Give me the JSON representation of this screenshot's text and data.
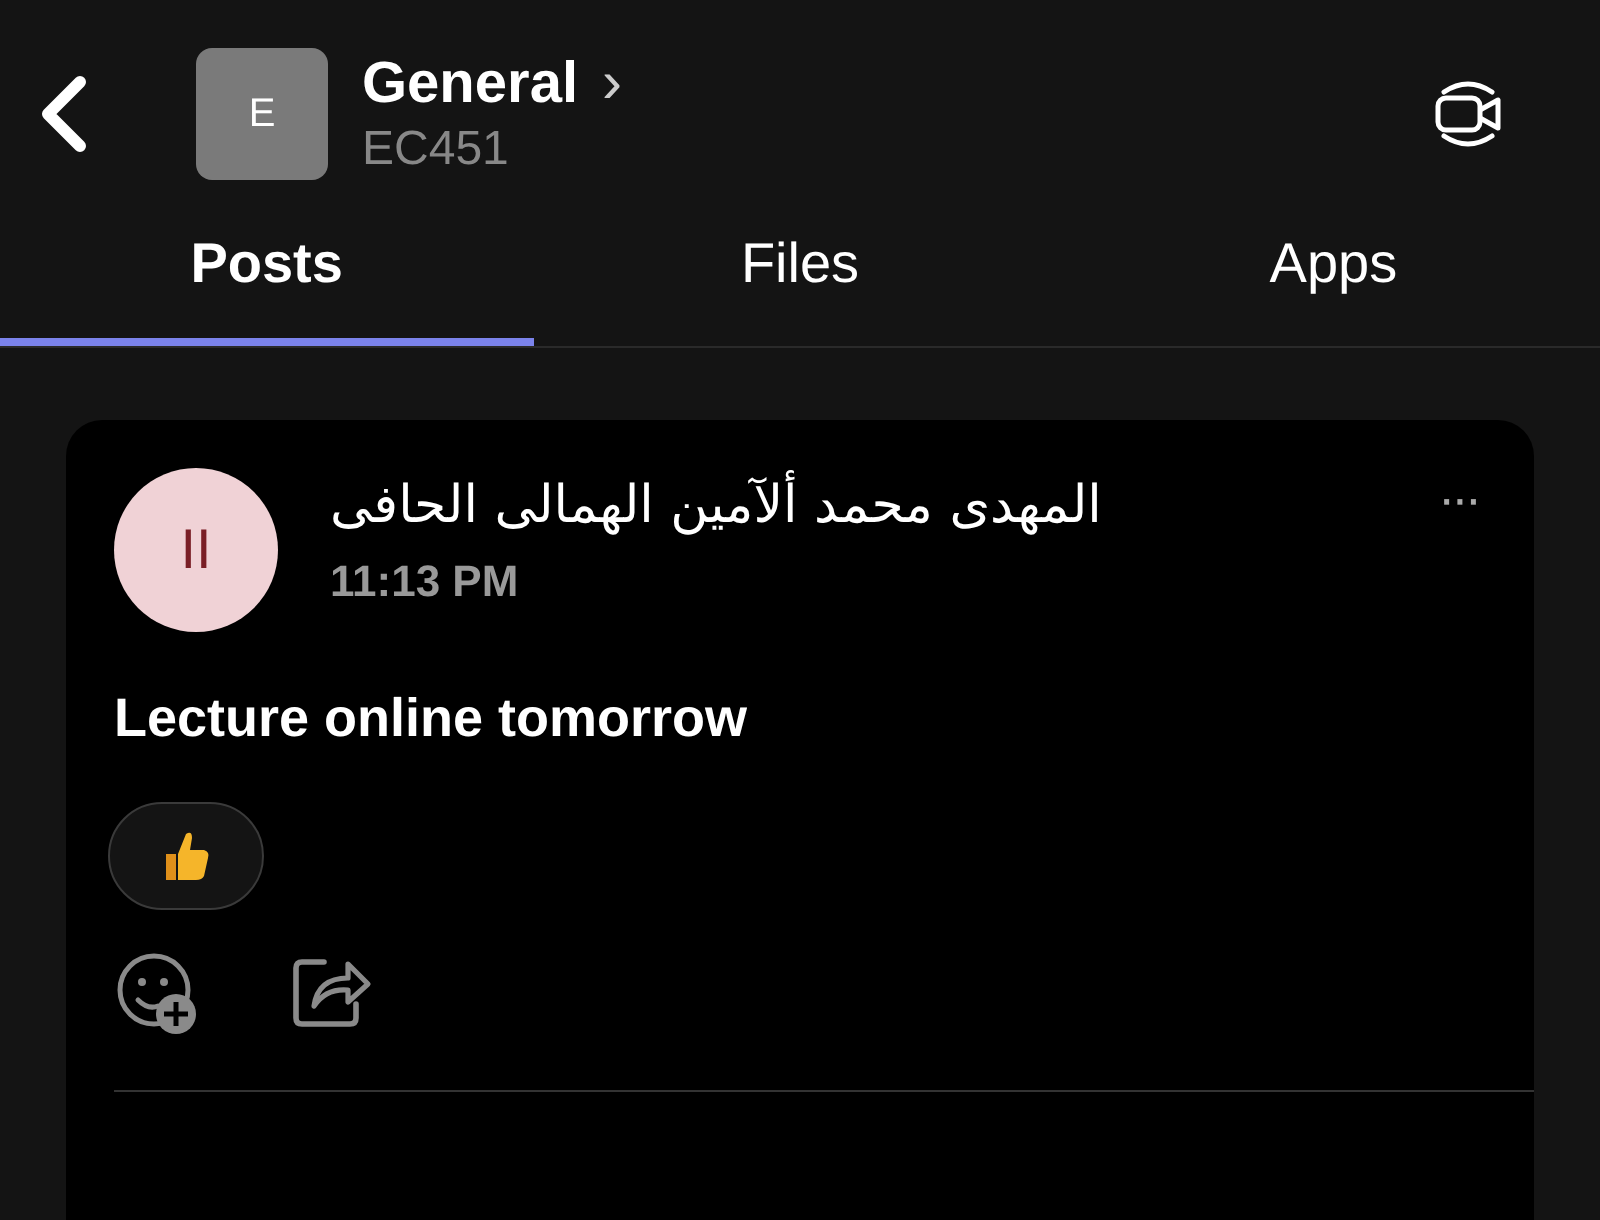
{
  "header": {
    "avatar_letter": "E",
    "title": "General",
    "title_chevron": "›",
    "subtitle": "EC451"
  },
  "tabs": [
    {
      "label": "Posts",
      "selected": true
    },
    {
      "label": "Files",
      "selected": false
    },
    {
      "label": "Apps",
      "selected": false
    }
  ],
  "post": {
    "author_initials": "II",
    "author": "المهدى محمد ألآمين الهمالى الحافى",
    "time": "11:13 PM",
    "body": "Lecture online tomorrow",
    "more": "···",
    "reactions": [
      {
        "kind": "thumbs-up"
      }
    ]
  }
}
